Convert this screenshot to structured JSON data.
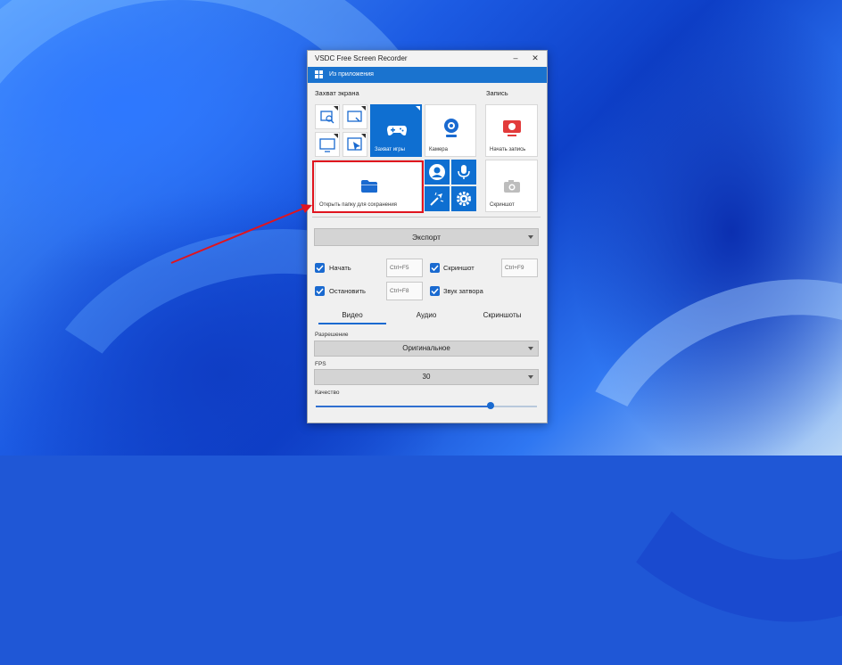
{
  "window": {
    "title": "VSDC Free Screen Recorder",
    "minimize_glyph": "–",
    "close_glyph": "✕",
    "accent_color": "#1a73cf"
  },
  "menu": {
    "from_apps_label": "Из приложения"
  },
  "capture_section": {
    "label": "Захват экрана",
    "tiles": [
      {
        "icon": "region-capture-icon"
      },
      {
        "icon": "window-capture-icon"
      },
      {
        "icon": "fullscreen-capture-icon"
      },
      {
        "icon": "cursor-capture-icon"
      },
      {
        "icon": "gamepad-icon",
        "label": "Захват игры",
        "selected": true
      },
      {
        "icon": "webcam-icon",
        "label": "Камера"
      }
    ],
    "open_folder_label": "Открыть папку для сохранения",
    "extra_tiles": [
      "user-icon",
      "microphone-icon",
      "cursor-effect-icon",
      "settings-gear-icon"
    ]
  },
  "record_section": {
    "label": "Запись",
    "start_label": "Начать запись",
    "screenshot_label": "Скриншот",
    "record_color": "#e23b3b"
  },
  "export": {
    "label": "Экспорт"
  },
  "hotkeys": [
    {
      "label": "Начать",
      "checked": true,
      "hotkey": "Ctrl+F5"
    },
    {
      "label": "Остановить",
      "checked": true,
      "hotkey": "Ctrl+F8"
    },
    {
      "label": "Скриншот",
      "checked": true,
      "hotkey": "Ctrl+F9"
    },
    {
      "label": "Звук затвора",
      "checked": true
    }
  ],
  "tabs": [
    {
      "label": "Видео",
      "active": true
    },
    {
      "label": "Аудио",
      "active": false
    },
    {
      "label": "Скриншоты",
      "active": false
    }
  ],
  "settings": {
    "resolution_label": "Разрешение",
    "resolution_value": "Оригинальное",
    "fps_label": "FPS",
    "fps_value": "30",
    "quality_label": "Качество",
    "quality_level": 0.79
  }
}
